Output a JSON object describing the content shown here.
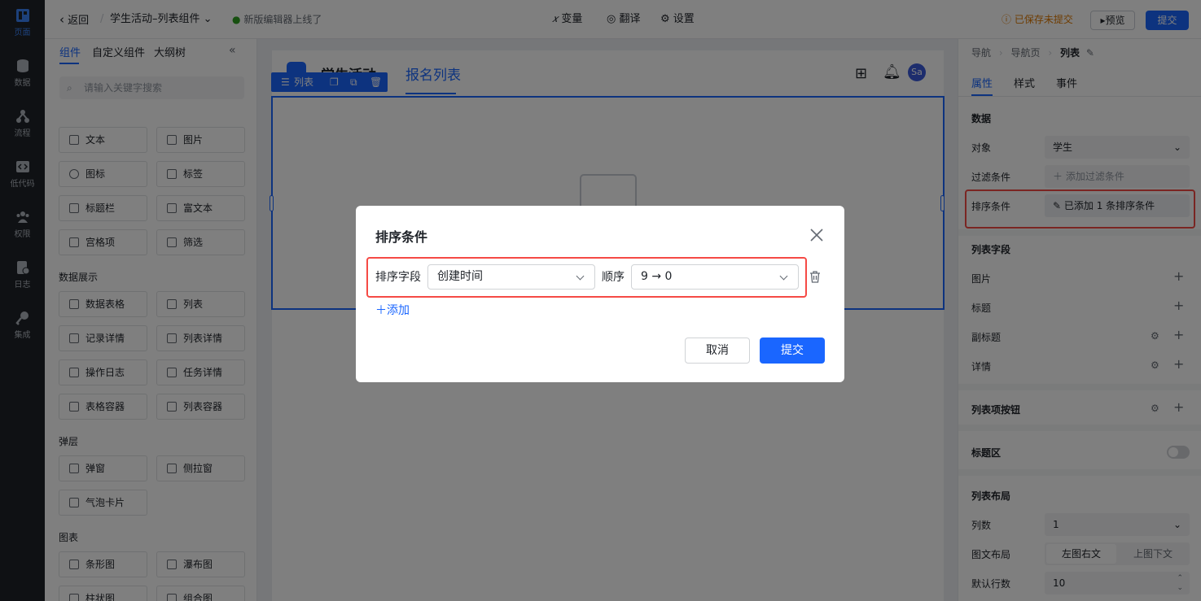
{
  "rail": [
    {
      "label": "页面",
      "icon": "page-icon",
      "active": true
    },
    {
      "label": "数据",
      "icon": "database-icon"
    },
    {
      "label": "流程",
      "icon": "flow-icon"
    },
    {
      "label": "低代码",
      "icon": "code-icon"
    },
    {
      "label": "权限",
      "icon": "users-icon"
    },
    {
      "label": "日志",
      "icon": "log-icon"
    },
    {
      "label": "集成",
      "icon": "key-icon"
    }
  ],
  "topbar": {
    "back": "返回",
    "title": "学生活动–列表组件",
    "notice": "新版编辑器上线了",
    "variable": "变量",
    "translate": "翻译",
    "settings": "设置",
    "save_status": "已保存未提交",
    "preview": "预览",
    "submit": "提交"
  },
  "left": {
    "tabs": [
      "组件",
      "自定义组件",
      "大纲树"
    ],
    "search_placeholder": "请输入关键字搜索",
    "rows1": [
      [
        "文本",
        "图片"
      ],
      [
        "图标",
        "标签"
      ],
      [
        "标题栏",
        "富文本"
      ],
      [
        "宫格项",
        "筛选"
      ]
    ],
    "section_display": "数据展示",
    "rows2": [
      [
        "数据表格",
        "列表"
      ],
      [
        "记录详情",
        "列表详情"
      ],
      [
        "操作日志",
        "任务详情"
      ],
      [
        "表格容器",
        "列表容器"
      ]
    ],
    "section_popup": "弹层",
    "rows3": [
      [
        "弹窗",
        "侧拉窗"
      ],
      [
        "气泡卡片",
        ""
      ]
    ],
    "section_chart": "图表",
    "rows4": [
      [
        "条形图",
        "瀑布图"
      ],
      [
        "柱状图",
        "组合图"
      ]
    ]
  },
  "canvas": {
    "app_name": "学生活动",
    "page_tab": "报名列表",
    "avatar": "Sa",
    "sel_label": "列表"
  },
  "right": {
    "breadcrumb": [
      "导航",
      "导航页",
      "列表"
    ],
    "tabs": [
      "属性",
      "样式",
      "事件"
    ],
    "data_title": "数据",
    "object_label": "对象",
    "object_value": "学生",
    "filter_label": "过滤条件",
    "filter_value": "添加过滤条件",
    "sort_label": "排序条件",
    "sort_value": "已添加 1 条排序条件",
    "fields_title": "列表字段",
    "fields": [
      "图片",
      "标题",
      "副标题",
      "详情"
    ],
    "item_buttons": "列表项按钮",
    "title_area": "标题区",
    "layout_title": "列表布局",
    "columns_label": "列数",
    "columns_value": "1",
    "img_layout_label": "图文布局",
    "img_layout_opt1": "左图右文",
    "img_layout_opt2": "上图下文",
    "rows_label": "默认行数",
    "rows_value": "10"
  },
  "modal": {
    "title": "排序条件",
    "field_label": "排序字段",
    "field_value": "创建时间",
    "order_label": "顺序",
    "order_value": "9 → 0",
    "add": "添加",
    "cancel": "取消",
    "submit": "提交"
  },
  "colors": {
    "accent": "#1a66ff",
    "highlight": "#f54a45",
    "rail": "#1f2329"
  }
}
